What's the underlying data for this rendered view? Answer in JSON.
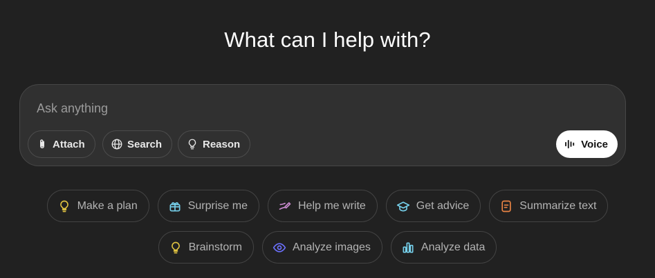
{
  "heading": "What can I help with?",
  "composer": {
    "placeholder": "Ask anything",
    "value": "",
    "tools": [
      {
        "label": "Attach",
        "icon": "paperclip-icon"
      },
      {
        "label": "Search",
        "icon": "globe-icon"
      },
      {
        "label": "Reason",
        "icon": "lightbulb-icon"
      }
    ],
    "voice": {
      "label": "Voice",
      "icon": "waveform-icon"
    }
  },
  "suggestions": {
    "row1": [
      {
        "label": "Make a plan",
        "icon": "lightbulb-icon",
        "color": "#e2c541"
      },
      {
        "label": "Surprise me",
        "icon": "gift-icon",
        "color": "#76d0eb"
      },
      {
        "label": "Help me write",
        "icon": "pen-icon",
        "color": "#cb8bd0"
      },
      {
        "label": "Get advice",
        "icon": "graduation-cap-icon",
        "color": "#76d0eb"
      },
      {
        "label": "Summarize text",
        "icon": "document-icon",
        "color": "#ea8444"
      }
    ],
    "row2": [
      {
        "label": "Brainstorm",
        "icon": "lightbulb-icon",
        "color": "#e2c541"
      },
      {
        "label": "Analyze images",
        "icon": "eye-icon",
        "color": "#6c71ff"
      },
      {
        "label": "Analyze data",
        "icon": "bar-chart-icon",
        "color": "#76d0eb"
      }
    ]
  }
}
